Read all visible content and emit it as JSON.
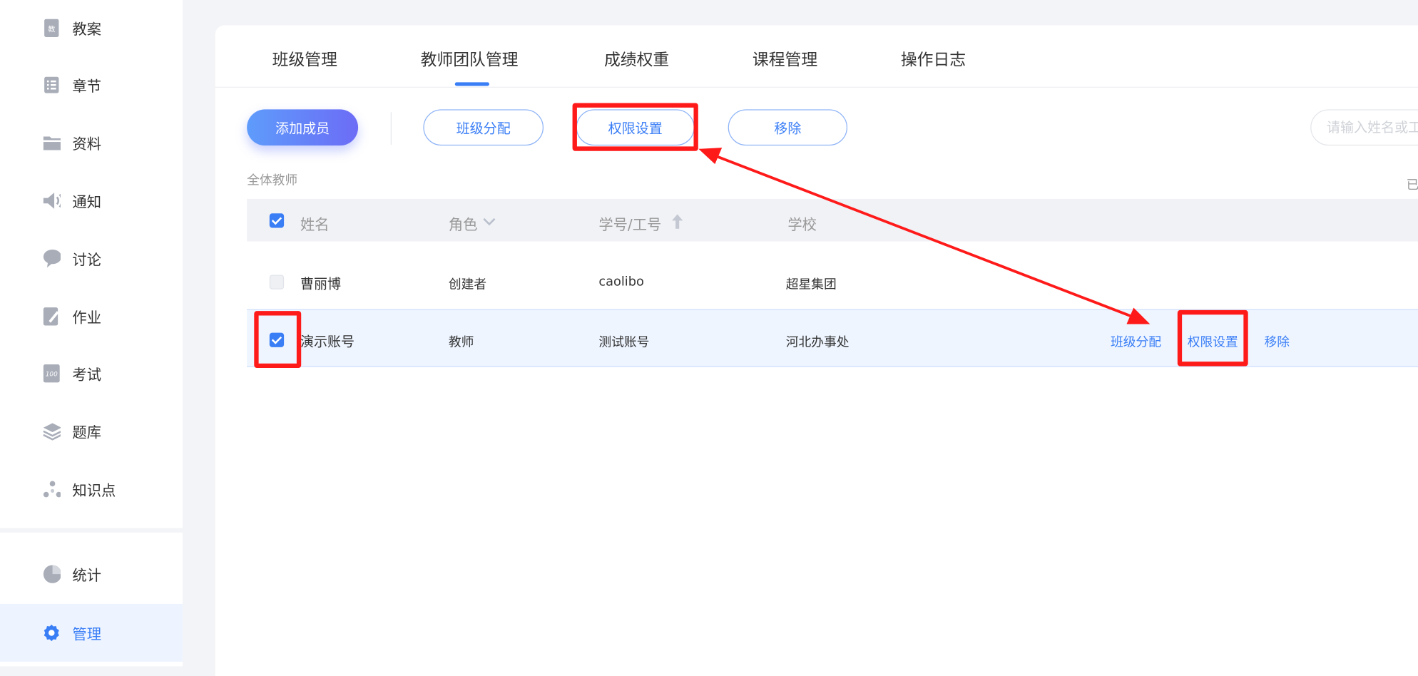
{
  "sidebar": {
    "items": [
      {
        "label": "教案",
        "icon": "lesson-plan-icon"
      },
      {
        "label": "章节",
        "icon": "chapter-list-icon"
      },
      {
        "label": "资料",
        "icon": "folder-icon"
      },
      {
        "label": "通知",
        "icon": "speaker-icon"
      },
      {
        "label": "讨论",
        "icon": "chat-bubble-icon"
      },
      {
        "label": "作业",
        "icon": "homework-icon"
      },
      {
        "label": "考试",
        "icon": "exam-icon"
      },
      {
        "label": "题库",
        "icon": "layers-icon"
      },
      {
        "label": "知识点",
        "icon": "knowledge-node-icon"
      }
    ],
    "bottom_items": [
      {
        "label": "统计",
        "icon": "pie-chart-icon"
      },
      {
        "label": "管理",
        "icon": "gear-icon",
        "active": true
      }
    ]
  },
  "tabs": [
    {
      "label": "班级管理"
    },
    {
      "label": "教师团队管理",
      "active": true
    },
    {
      "label": "成绩权重"
    },
    {
      "label": "课程管理"
    },
    {
      "label": "操作日志"
    }
  ],
  "toolbar": {
    "add_member": "添加成员",
    "class_assign": "班级分配",
    "permission": "权限设置",
    "remove": "移除",
    "search_placeholder": "请输入姓名或工号"
  },
  "section_label": "全体教师",
  "selected_hint": "已",
  "table": {
    "headers": {
      "name": "姓名",
      "role": "角色",
      "id": "学号/工号",
      "school": "学校"
    },
    "rows": [
      {
        "name": "曹丽博",
        "role": "创建者",
        "id": "caolibo",
        "school": "超星集团",
        "checked": false
      },
      {
        "name": "演示账号",
        "role": "教师",
        "id": "测试账号",
        "school": "河北办事处",
        "checked": true,
        "actions": [
          "班级分配",
          "权限设置",
          "移除"
        ]
      }
    ]
  },
  "colors": {
    "accent": "#3a7ef6",
    "annotation": "#ff1a1a",
    "selected_row": "#eef5ff"
  }
}
